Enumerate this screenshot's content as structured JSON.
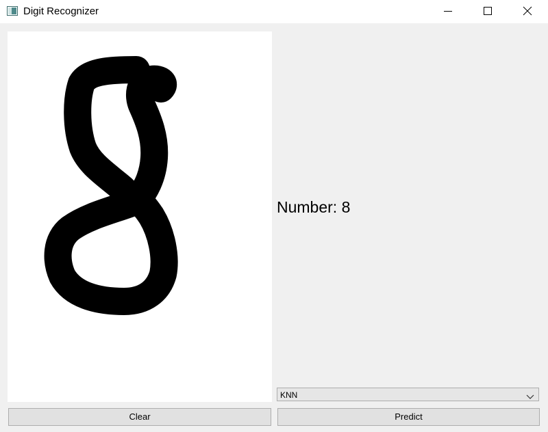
{
  "window": {
    "title": "Digit Recognizer",
    "icon": "app-window-icon"
  },
  "titlebar_buttons": {
    "minimize": "minimize-icon",
    "maximize": "maximize-icon",
    "close": "close-icon"
  },
  "result": {
    "text": "Number: 8"
  },
  "model_select": {
    "selected": "KNN",
    "icon": "chevron-down-icon"
  },
  "buttons": {
    "clear_label": "Clear",
    "predict_label": "Predict"
  },
  "colors": {
    "canvas_background": "#ffffff",
    "stroke": "#000000",
    "window_background": "#f0f0f0"
  }
}
